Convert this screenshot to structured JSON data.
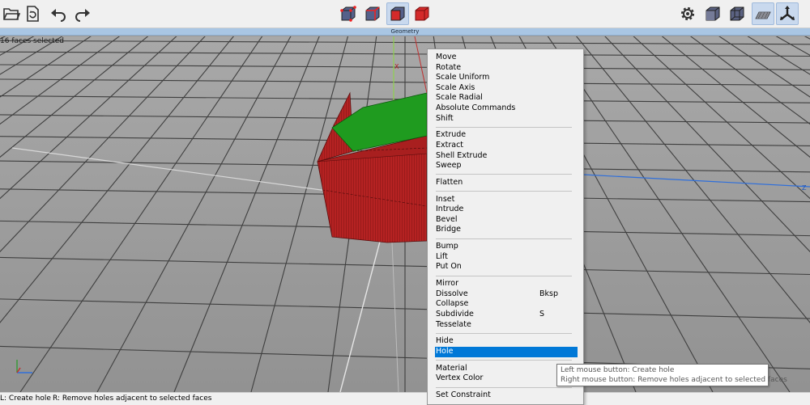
{
  "viewport": {
    "title": "Geometry",
    "selection_info": "16 faces selected",
    "axis_label_x": "X",
    "axis_label_z": "Z"
  },
  "toolbar": {
    "file_buttons": [
      {
        "icon": "open-folder-icon"
      },
      {
        "icon": "reload-document-icon"
      },
      {
        "icon": "undo-icon"
      },
      {
        "icon": "redo-icon"
      }
    ],
    "mode_buttons": [
      {
        "icon": "vertex-mode-icon",
        "active": false
      },
      {
        "icon": "edge-mode-icon",
        "active": false
      },
      {
        "icon": "face-mode-icon",
        "active": true
      },
      {
        "icon": "object-mode-icon",
        "active": false
      }
    ],
    "view_buttons": [
      {
        "icon": "gear-icon",
        "active": false
      },
      {
        "icon": "shaded-cube-icon",
        "active": false
      },
      {
        "icon": "wireframe-cube-icon",
        "active": false
      },
      {
        "icon": "grid-floor-icon",
        "active": true
      },
      {
        "icon": "axes-icon",
        "active": true
      }
    ]
  },
  "context_menu": {
    "groups": [
      [
        {
          "label": "Move"
        },
        {
          "label": "Rotate"
        },
        {
          "label": "Scale Uniform"
        },
        {
          "label": "Scale Axis"
        },
        {
          "label": "Scale Radial"
        },
        {
          "label": "Absolute Commands"
        },
        {
          "label": "Shift"
        }
      ],
      [
        {
          "label": "Extrude"
        },
        {
          "label": "Extract"
        },
        {
          "label": "Shell Extrude"
        },
        {
          "label": "Sweep"
        }
      ],
      [
        {
          "label": "Flatten"
        }
      ],
      [
        {
          "label": "Inset"
        },
        {
          "label": "Intrude"
        },
        {
          "label": "Bevel"
        },
        {
          "label": "Bridge"
        }
      ],
      [
        {
          "label": "Bump"
        },
        {
          "label": "Lift"
        },
        {
          "label": "Put On"
        }
      ],
      [
        {
          "label": "Mirror"
        },
        {
          "label": "Dissolve",
          "shortcut": "Bksp"
        },
        {
          "label": "Collapse"
        },
        {
          "label": "Subdivide",
          "shortcut": "S"
        },
        {
          "label": "Tesselate"
        }
      ],
      [
        {
          "label": "Hide"
        },
        {
          "label": "Hole",
          "highlighted": true
        }
      ],
      [
        {
          "label": "Material"
        },
        {
          "label": "Vertex Color"
        }
      ],
      [
        {
          "label": "Set Constraint"
        }
      ]
    ]
  },
  "tooltip": {
    "line1": "Left mouse button: Create hole",
    "line2": "Right mouse button: Remove holes adjacent to selected faces"
  },
  "statusbar": {
    "left": "L: Create hole",
    "right": "R: Remove holes adjacent to selected faces"
  },
  "colors": {
    "toolbar_bg": "#f0f0f0",
    "menu_highlight": "#0078d7",
    "mesh_red": "#b52222",
    "mesh_green": "#1f9b1f",
    "viewport_bg": "#9e9e9e"
  }
}
